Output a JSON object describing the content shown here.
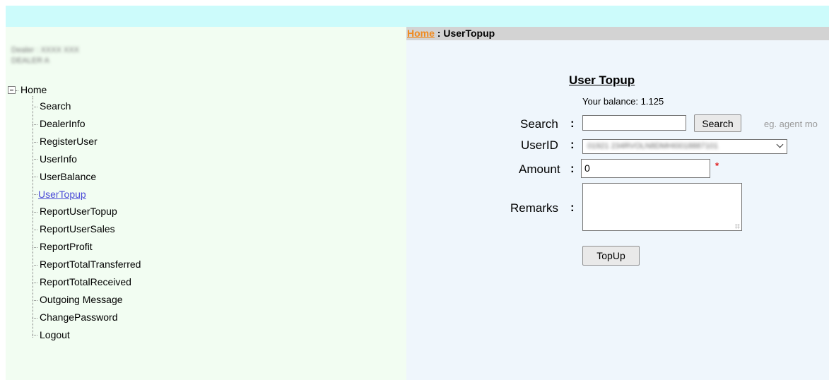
{
  "breadcrumb": {
    "home": "Home",
    "separator": " : ",
    "current": "UserTopup"
  },
  "dealer": {
    "line1": "Dealer : XXXX XXX",
    "line2": "DEALER A"
  },
  "tree": {
    "root": "Home",
    "items": [
      {
        "label": "Search",
        "active": false
      },
      {
        "label": "DealerInfo",
        "active": false
      },
      {
        "label": "RegisterUser",
        "active": false
      },
      {
        "label": "UserInfo",
        "active": false
      },
      {
        "label": "UserBalance",
        "active": false
      },
      {
        "label": "UserTopup",
        "active": true
      },
      {
        "label": "ReportUserTopup",
        "active": false
      },
      {
        "label": "ReportUserSales",
        "active": false
      },
      {
        "label": "ReportProfit",
        "active": false
      },
      {
        "label": "ReportTotalTransferred",
        "active": false
      },
      {
        "label": "ReportTotalReceived",
        "active": false
      },
      {
        "label": "Outgoing Message",
        "active": false
      },
      {
        "label": "ChangePassword",
        "active": false
      },
      {
        "label": "Logout",
        "active": false
      }
    ]
  },
  "form": {
    "title": "User Topup",
    "balance": "Your balance: 1.125",
    "search_label": "Search",
    "colon": ":",
    "search_value": "",
    "search_button": "Search",
    "search_hint": "eg. agent mo",
    "userid_label": "UserID",
    "userid_selected": "01921 234RVOLN8DMHI0018887101",
    "amount_label": "Amount",
    "amount_value": "0",
    "required_mark": "*",
    "remarks_label": "Remarks",
    "remarks_value": "",
    "topup_button": "TopUp"
  },
  "colors": {
    "topbar": "#ccfbfb",
    "sidebar": "#f2fdf2",
    "main": "#eff6fc",
    "breadcrumb_home": "#f08a1e",
    "active_link": "#4b4bd8",
    "required": "#e01b1b"
  }
}
